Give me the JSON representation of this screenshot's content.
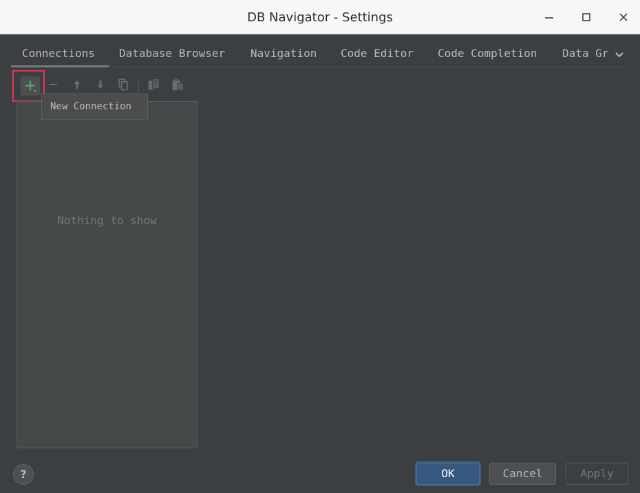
{
  "window": {
    "title": "DB Navigator - Settings"
  },
  "tabs": [
    {
      "label": "Connections",
      "active": true
    },
    {
      "label": "Database Browser",
      "active": false
    },
    {
      "label": "Navigation",
      "active": false
    },
    {
      "label": "Code Editor",
      "active": false
    },
    {
      "label": "Code Completion",
      "active": false
    },
    {
      "label": "Data Gr",
      "active": false
    }
  ],
  "toolbar": {
    "buttons": [
      "add-icon",
      "remove-icon",
      "move-up-icon",
      "move-down-icon",
      "copy-icon",
      "cut-icon",
      "paste-icon"
    ]
  },
  "tooltip": {
    "text": "New Connection"
  },
  "connections_list": {
    "empty_text": "Nothing to show"
  },
  "footer": {
    "help_label": "?",
    "ok_label": "OK",
    "cancel_label": "Cancel",
    "apply_label": "Apply"
  },
  "colors": {
    "background": "#3c3f41",
    "add_icon": "#59a869",
    "highlight": "#e8315a",
    "ok_button": "#365880"
  }
}
